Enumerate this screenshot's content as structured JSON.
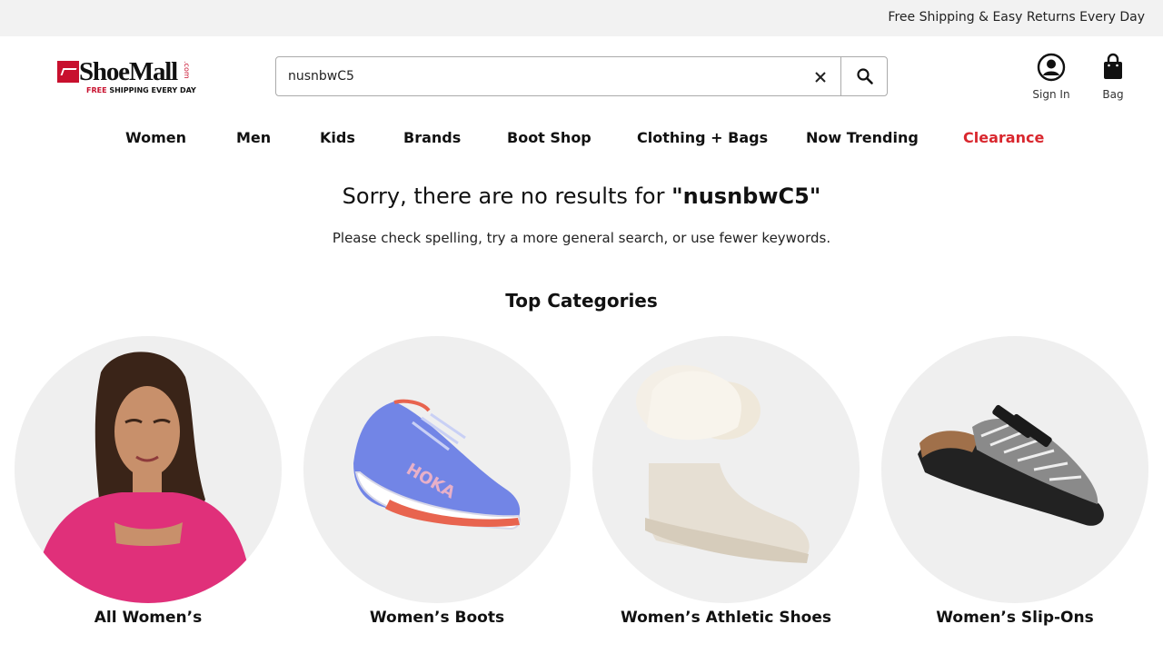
{
  "promo": {
    "text": "Free Shipping & Easy Returns Every Day"
  },
  "logo": {
    "word": "ShoeMall",
    "com": ".com",
    "tag_red": "FREE",
    "tag_rest": " SHIPPING EVERY DAY"
  },
  "search": {
    "value": "nusnbwC5",
    "placeholder": ""
  },
  "header": {
    "sign_in_label": "Sign In",
    "bag_label": "Bag"
  },
  "nav": {
    "items": [
      {
        "label": "Women"
      },
      {
        "label": "Men"
      },
      {
        "label": "Kids"
      },
      {
        "label": "Brands"
      },
      {
        "label": "Boot Shop"
      },
      {
        "label": "Clothing + Bags"
      },
      {
        "label": "Now Trending"
      },
      {
        "label": "Clearance"
      }
    ],
    "sale_color": "#d9272e"
  },
  "results": {
    "message_prefix": "Sorry, there are no results for ",
    "query_quoted": "\"nusnbwC5\"",
    "hint": "Please check spelling, try a more general search, or use fewer keywords."
  },
  "top_categories": {
    "title": "Top Categories",
    "items": [
      {
        "label": "All Women’s"
      },
      {
        "label": "Women’s Boots"
      },
      {
        "label": "Women’s Athletic Shoes"
      },
      {
        "label": "Women’s Slip-Ons"
      }
    ]
  },
  "colors": {
    "brand_red": "#c8102e",
    "promo_bg": "#f2f2f2",
    "circle_bg": "#efefef"
  }
}
